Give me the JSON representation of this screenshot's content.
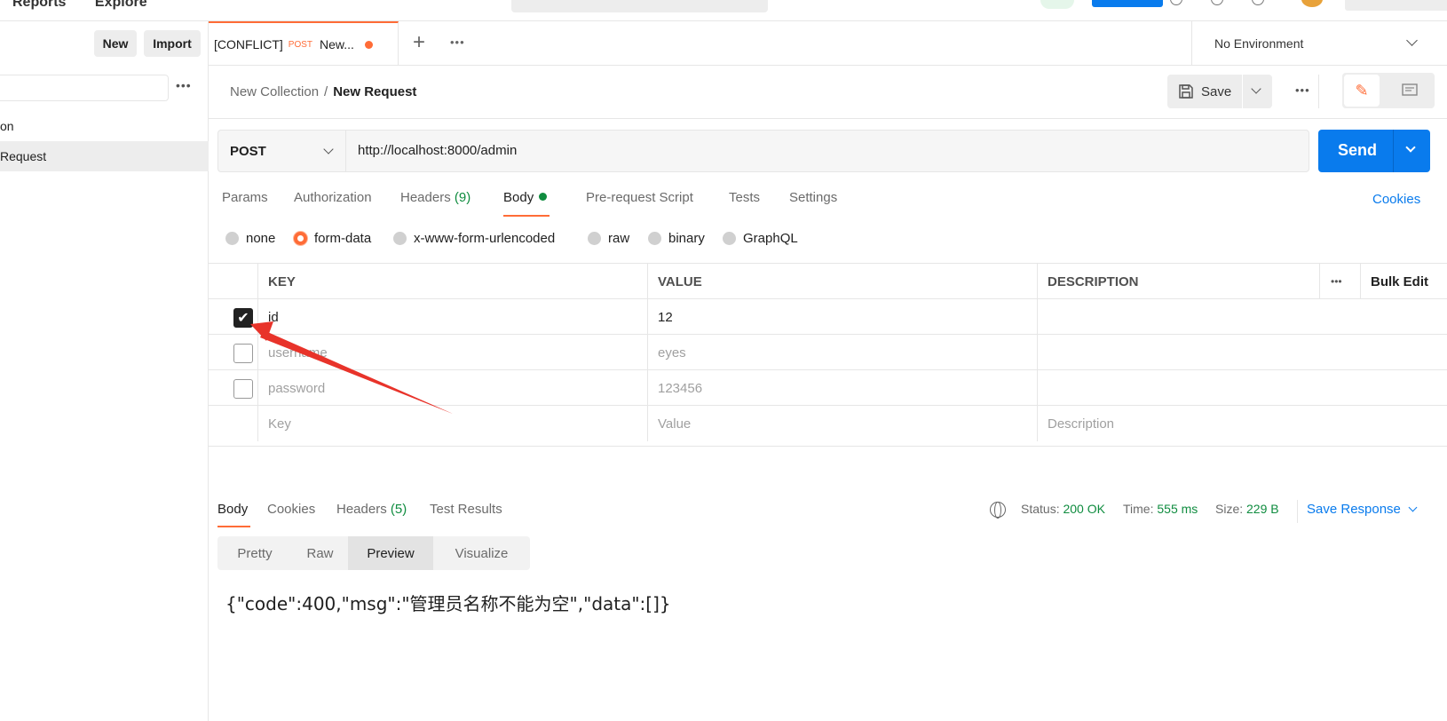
{
  "topbar": {
    "nav": [
      "Reports",
      "Explore"
    ]
  },
  "sidebar": {
    "new_label": "New",
    "import_label": "Import",
    "items": [
      {
        "label": "on"
      },
      {
        "label": "Request"
      }
    ]
  },
  "tabs": {
    "active": {
      "conflict": "[CONFLICT]",
      "method": "POST",
      "name": "New..."
    },
    "environment": "No Environment"
  },
  "breadcrumb": {
    "collection": "New Collection",
    "separator": "/",
    "request": "New Request"
  },
  "toolbar": {
    "save_label": "Save"
  },
  "request": {
    "method": "POST",
    "url": "http://localhost:8000/admin",
    "send_label": "Send",
    "tabs": [
      {
        "label": "Params"
      },
      {
        "label": "Authorization"
      },
      {
        "label": "Headers",
        "count": "(9)"
      },
      {
        "label": "Body"
      },
      {
        "label": "Pre-request Script"
      },
      {
        "label": "Tests"
      },
      {
        "label": "Settings"
      }
    ],
    "cookies_label": "Cookies",
    "body_types": [
      "none",
      "form-data",
      "x-www-form-urlencoded",
      "raw",
      "binary",
      "GraphQL"
    ],
    "selected_body_type": "form-data"
  },
  "form_table": {
    "headers": {
      "key": "KEY",
      "value": "VALUE",
      "description": "DESCRIPTION",
      "bulk_edit": "Bulk Edit"
    },
    "rows": [
      {
        "checked": true,
        "key": "id",
        "value": "12",
        "description": ""
      },
      {
        "checked": false,
        "key": "username",
        "value": "eyes",
        "description": ""
      },
      {
        "checked": false,
        "key": "password",
        "value": "123456",
        "description": ""
      }
    ],
    "placeholder": {
      "key": "Key",
      "value": "Value",
      "description": "Description"
    }
  },
  "response": {
    "tabs": [
      {
        "label": "Body"
      },
      {
        "label": "Cookies"
      },
      {
        "label": "Headers",
        "count": "(5)"
      },
      {
        "label": "Test Results"
      }
    ],
    "status_label": "Status:",
    "status_value": "200 OK",
    "time_label": "Time:",
    "time_value": "555 ms",
    "size_label": "Size:",
    "size_value": "229 B",
    "save_response_label": "Save Response",
    "view_modes": [
      "Pretty",
      "Raw",
      "Preview",
      "Visualize"
    ],
    "active_view": "Preview",
    "body": "{\"code\":400,\"msg\":\"管理员名称不能为空\",\"data\":[]}"
  },
  "colors": {
    "accent": "#ff6c37",
    "primary": "#097bed",
    "success": "#0f8c3f"
  }
}
